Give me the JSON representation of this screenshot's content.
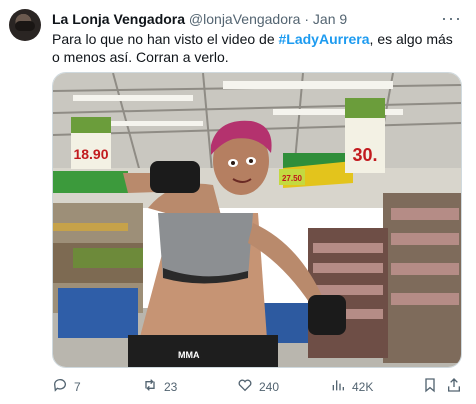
{
  "tweet": {
    "author_name": "La Lonja Vengadora",
    "handle": "@lonjaVengadora",
    "separator": "·",
    "date": "Jan 9",
    "text_before": "Para lo que no han visto el video de ",
    "hashtag": "#LadyAurrera",
    "text_after": ", es algo más o menos así. Corran a verlo."
  },
  "media": {
    "signs": [
      "18.90",
      "30.",
      "27.50"
    ],
    "shorts_text": "MMA"
  },
  "actions": {
    "replies": "7",
    "reposts": "23",
    "likes": "240",
    "views": "42K"
  },
  "icons": {
    "more": "more-icon",
    "reply": "reply-icon",
    "repost": "repost-icon",
    "like": "heart-icon",
    "views": "views-icon",
    "bookmark": "bookmark-icon",
    "share": "share-icon"
  },
  "colors": {
    "accent": "#1d9bf0",
    "muted": "#536471",
    "text": "#0f1419"
  }
}
